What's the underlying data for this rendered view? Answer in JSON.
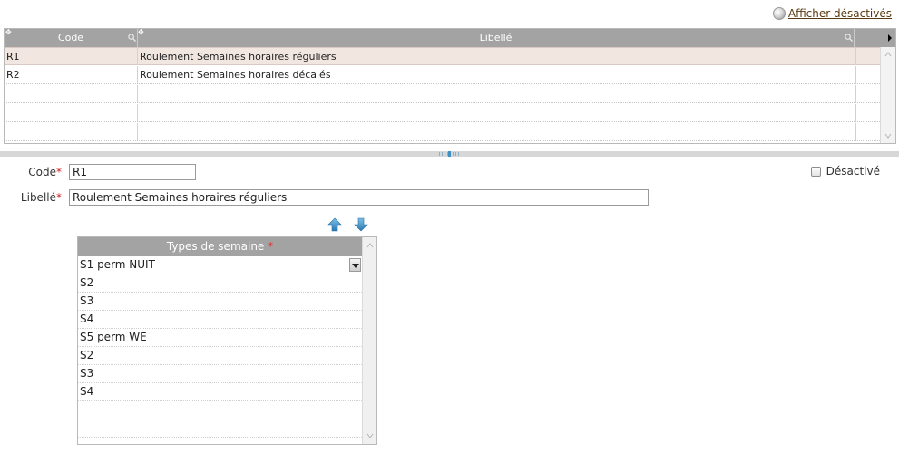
{
  "toolbar": {
    "show_disabled_label": "Afficher désactivés"
  },
  "grid": {
    "columns": [
      "Code",
      "Libellé"
    ],
    "rows": [
      {
        "code": "R1",
        "label": "Roulement Semaines horaires réguliers"
      },
      {
        "code": "R2",
        "label": "Roulement Semaines horaires décalés"
      }
    ]
  },
  "form": {
    "code_label": "Code",
    "code_value": "R1",
    "label_label": "Libellé",
    "label_value": "Roulement Semaines horaires réguliers",
    "required_mark": "*",
    "disabled_label": "Désactivé"
  },
  "types": {
    "header": "Types de semaine",
    "required_mark": "*",
    "items": [
      "S1 perm NUIT",
      "S2",
      "S3",
      "S4",
      "S5 perm WE",
      "S2",
      "S3",
      "S4"
    ]
  },
  "colors": {
    "header_bg": "#a3a3a3",
    "selected_row": "#f2e6e0",
    "arrow_blue": "#3a8fc6",
    "link": "#5a3a10"
  },
  "icons": [
    "search-icon",
    "up-arrow-icon",
    "down-arrow-icon",
    "dropdown-icon"
  ]
}
